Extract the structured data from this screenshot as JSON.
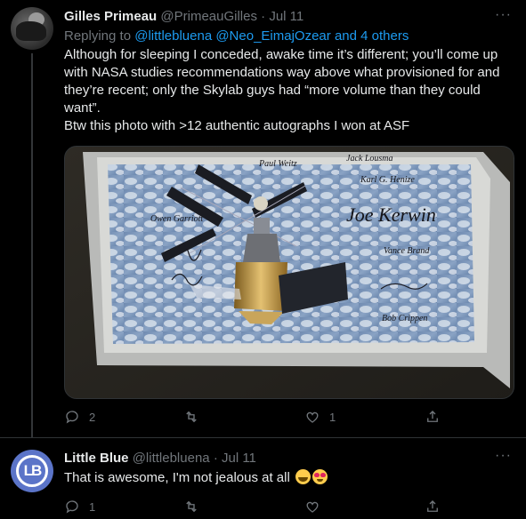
{
  "tweet1": {
    "name": "Gilles Primeau",
    "handle": "@PrimeauGilles",
    "separator": "·",
    "date": "Jul 11",
    "more": "···",
    "replying_prefix": "Replying to",
    "replying_mentions": "@littlebluena @Neo_EimajOzear",
    "replying_suffix": "and 4 others",
    "text": "Although for sleeping I conceded, awake time it’s different; you’ll come up with NASA studies recommendations way above what provisioned for and they’re recent; only the Skylab guys had “more volume than they could want”.",
    "text2": "Btw this photo with >12 authentic autographs I won at ASF",
    "actions": {
      "replies": "2",
      "retweets": "",
      "likes": "1"
    },
    "photo_signatures": [
      "Paul Weitz",
      "Jack Lousma",
      "Karl G. Henize",
      "Joe Kerwin",
      "Owen Garriott",
      "Vance Brand",
      "Bob Crippen"
    ]
  },
  "tweet2": {
    "name": "Little Blue",
    "handle": "@littlebluena",
    "separator": "·",
    "date": "Jul 11",
    "more": "···",
    "text": "That is awesome, I'm not jealous at all",
    "avatar_letters": "LB",
    "actions": {
      "replies": "1",
      "retweets": "",
      "likes": ""
    }
  },
  "icons": [
    "reply-icon",
    "retweet-icon",
    "like-icon",
    "share-icon",
    "more-icon"
  ],
  "colors": {
    "background": "#000000",
    "text": "#e7e9ea",
    "muted": "#71767b",
    "link": "#1d9bf0"
  }
}
